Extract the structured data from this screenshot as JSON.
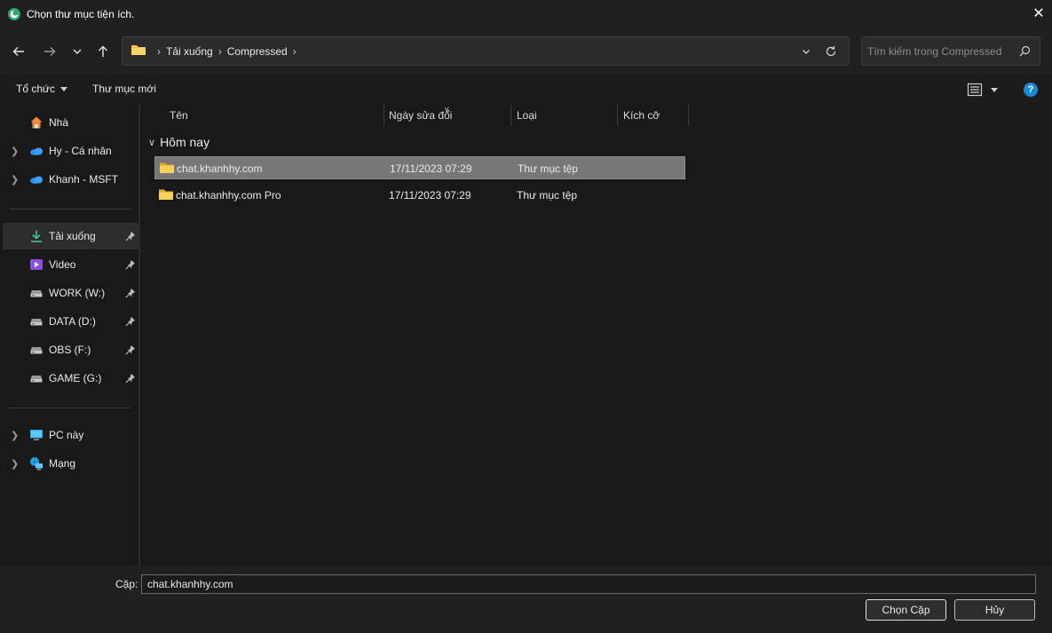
{
  "window": {
    "title": "Chọn thư mục tiện ích.",
    "close_glyph": "✕"
  },
  "navigation": {
    "back_icon": "arrow-left-icon",
    "forward_icon": "arrow-right-icon",
    "recent_icon": "chevron-down-icon",
    "up_icon": "arrow-up-icon"
  },
  "address": {
    "segments": [
      "Tải xuống",
      "Compressed"
    ],
    "separator": "›"
  },
  "search": {
    "placeholder": "Tìm kiếm trong Compressed"
  },
  "toolbar": {
    "organize_label": "Tổ chức",
    "new_folder_label": "Thư mục mới",
    "help_label": "?"
  },
  "sidebar": {
    "items": [
      {
        "label": "Nhà",
        "icon": "home-icon",
        "expandable": false,
        "pinned": false
      },
      {
        "label": "Hy - Cá nhân",
        "icon": "onedrive-icon",
        "expandable": true,
        "pinned": false
      },
      {
        "label": "Khanh - MSFT",
        "icon": "onedrive-icon",
        "expandable": true,
        "pinned": false
      },
      {
        "label": "Tải xuống",
        "icon": "download-icon",
        "expandable": false,
        "pinned": true,
        "selected": true
      },
      {
        "label": "Video",
        "icon": "video-icon",
        "expandable": false,
        "pinned": true
      },
      {
        "label": "WORK (W:)",
        "icon": "drive-icon",
        "expandable": false,
        "pinned": true
      },
      {
        "label": "DATA (D:)",
        "icon": "drive-icon",
        "expandable": false,
        "pinned": true
      },
      {
        "label": "OBS (F:)",
        "icon": "drive-icon",
        "expandable": false,
        "pinned": true
      },
      {
        "label": "GAME (G:)",
        "icon": "drive-icon",
        "expandable": false,
        "pinned": true
      },
      {
        "label": "PC này",
        "icon": "pc-icon",
        "expandable": true,
        "pinned": false
      },
      {
        "label": "Mạng",
        "icon": "network-icon",
        "expandable": true,
        "pinned": false
      }
    ]
  },
  "filelist": {
    "columns": [
      "Tên",
      "Ngày sửa đổi",
      "Loại",
      "Kích cỡ"
    ],
    "group": "Hôm nay",
    "rows": [
      {
        "name": "chat.khanhhy.com",
        "date": "17/11/2023 07:29",
        "type": "Thư mục tệp",
        "size": "",
        "selected": true
      },
      {
        "name": "chat.khanhhy.com Pro",
        "date": "17/11/2023 07:29",
        "type": "Thư mục tệp",
        "size": "",
        "selected": false
      }
    ]
  },
  "footer": {
    "folder_label": "Cặp:",
    "folder_value": "chat.khanhhy.com",
    "select_button": "Chọn Cặp",
    "cancel_button": "Hủy"
  },
  "colors": {
    "accent": "#1a8ad4",
    "folder": "#f2c14e",
    "selection": "#777777"
  }
}
